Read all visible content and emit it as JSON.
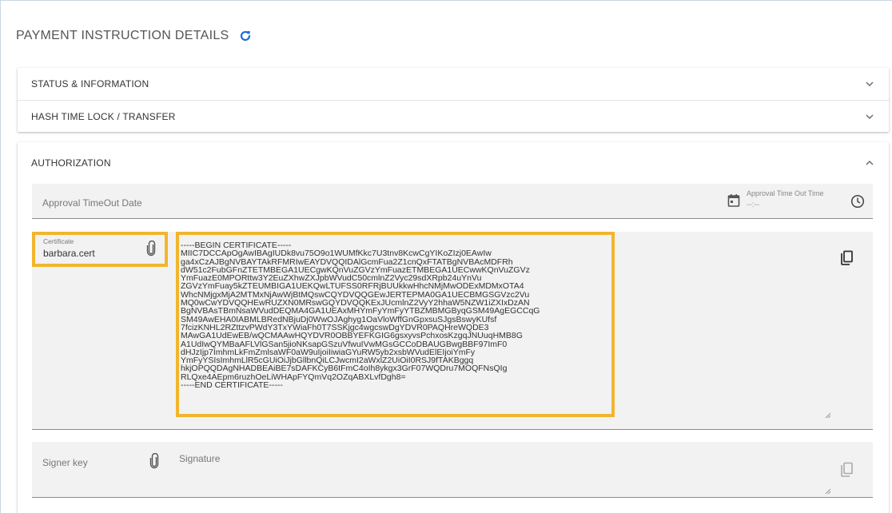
{
  "page": {
    "title": "PAYMENT INSTRUCTION DETAILS",
    "refresh_icon": "refresh-icon",
    "accent": "#1f6fd1"
  },
  "panels": [
    {
      "label": "STATUS & INFORMATION",
      "icon": "chevron-down-icon"
    },
    {
      "label": "HASH TIME LOCK / TRANSFER",
      "icon": "chevron-down-icon"
    }
  ],
  "authorization": {
    "label": "AUTHORIZATION",
    "icon": "chevron-up-icon",
    "approval_date": {
      "placeholder": "Approval TimeOut Date",
      "icon": "calendar-icon"
    },
    "approval_time": {
      "label": "Approval Time Out Time",
      "value": "--:--",
      "icon": "clock-icon"
    },
    "certificate": {
      "label": "Certificate",
      "value": "barbara.cert",
      "icon": "paperclip-icon",
      "highlight": "#f2b52c",
      "text": "-----BEGIN CERTIFICATE-----\nMIIC7DCCApOgAwIBAgIUDk8vu75O9o1WUMfKkc7U3tnv8KcwCgYIKoZIzj0EAwIw\nga4xCzAJBgNVBAYTAkRFMRIwEAYDVQQIDAlGcmFua2Z1cnQxFTATBgNVBAcMDFRh\ndW51c2FubGFnZTETMBEGA1UECgwKQnVuZGVzYmFuazETMBEGA1UECwwKQnVuZGVz\nYmFuazE0MPORttw3Y2EuZXhwZXJpbWVudC50cmlnZ2Vyc29sdXRpb24uYnVu\nZGVzYmFuay5kZTEUMBIGA1UEKQwLTUFSS0RFRjBUUkkwHhcNMjMwODExMDMxOTA4\nWhcNMjgxMjA2MTMxNjAwWjBtMQswCQYDVQQGEwJERTEPMA0GA1UECBMGSGVzc2Vu\nMQ0wCwYDVQQHEwRUZXN0MRswGQYDVQQKExJUcmlnZ2VyY2hhaW5NZW1iZXIxDzAN\nBgNVBAsTBmNsaWVudDEQMA4GA1UEAxMHYmFyYmFyYTBZMBMGByqGSM49AgEGCCqG\nSM49AwEHA0IABMLBRedNBjuDj0WwOJAghyg1OaVloWffGnGpxsuSJgsBswyKUfsf\n7fcizKNHL2RZttzvPWdY3TxYWiaFh0T7SSKjgc4wgcswDgYDVR0PAQHreWQDE3\nMAwGA1UdEwEB/wQCMAAwHQYDVR0OBBYEFKGIG6gsxyvsPchxosKzgqJNUuqHMB8G\nA1UdIwQYMBaAFLVlGSan5jioNKsapGSzuVfwuIVwMGsGCCoDBAUGBwgBBF97ImF0\ndHJzIjp7ImhmLkFmZmlsaWF0aW9uIjoiIiwiaGYuRW5yb2xsbWVudElEIjoiYmFy\nYmFyYSIsImhmLlR5cGUiOiJjbGllbnQiLCJwcmI2aWxlZ2UiOiI0RSJ9fTAKBggq\nhkjOPQQDAgNHADBEAiBE7sDAFKCyB6tFmC4oIh8ykgx3GrF07WQDru7MOQFNsQIg\nRLQxe4AEpm6ruzhOeLiWHApFYQmVq2OZqABXLvfDgh8=\n-----END CERTIFICATE-----",
      "copy_icon": "copy-icon"
    },
    "signer": {
      "placeholder": "Signer key",
      "icon": "paperclip-icon"
    },
    "signature": {
      "placeholder": "Signature",
      "copy_icon": "copy-icon"
    }
  }
}
